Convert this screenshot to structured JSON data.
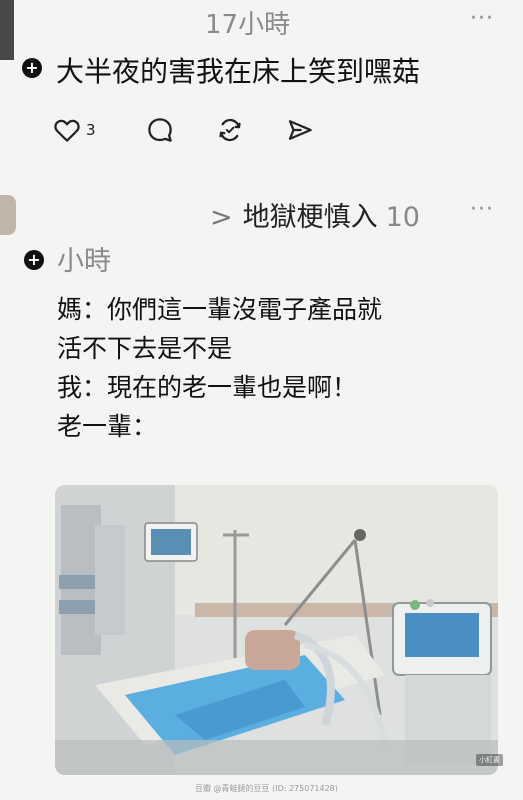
{
  "post_top": {
    "time": "17小時",
    "more": "···",
    "text": "大半夜的害我在床上笑到嘿菇",
    "actions": {
      "like_count": "3",
      "like_icon": "heart-icon",
      "comment_icon": "comment-icon",
      "repost_icon": "repost-icon",
      "share_icon": "send-icon"
    }
  },
  "post_reply": {
    "chevron": ">",
    "reply_to": "地獄梗慎入",
    "number": "10",
    "more": "···",
    "time": "小時",
    "lines": [
      "媽：你們這一輩沒電子產品就",
      "活不下去是不是",
      "我：現在的老一輩也是啊！",
      "老一輩："
    ],
    "image_tag": "小紅書",
    "watermark": "豆瓣  @青蛙腿的豆豆 (ID: 275071428)"
  },
  "colors": {
    "background": "#f4f4f2",
    "text": "#111111",
    "muted": "#8a8a8a",
    "bed_sheet": "#5aaee0"
  }
}
